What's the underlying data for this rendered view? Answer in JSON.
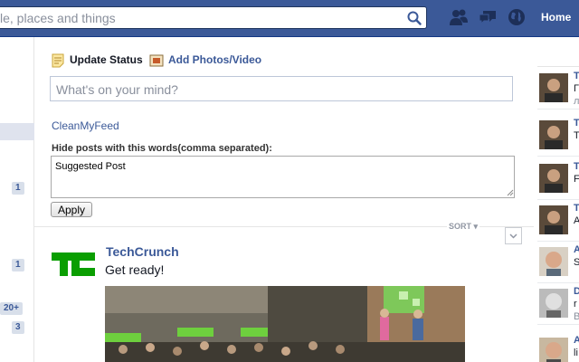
{
  "header": {
    "search_text": "le, places and things",
    "home_label": "Home",
    "icons": [
      "friend-requests-icon",
      "messages-icon",
      "notifications-globe-icon"
    ]
  },
  "left_rail": {
    "badges": [
      "1",
      "1",
      "20+",
      "3"
    ]
  },
  "composer": {
    "tabs": [
      {
        "label": "Update Status",
        "icon": "status-note-icon"
      },
      {
        "label": "Add Photos/Video",
        "icon": "photo-icon"
      }
    ],
    "placeholder": "What's on your mind?"
  },
  "cleanmyfeed": {
    "link": "CleanMyFeed",
    "label": "Hide posts with this words(comma separated):",
    "textarea_value": "Suggested Post",
    "apply_label": "Apply"
  },
  "feed": {
    "sort_label": "SORT",
    "post": {
      "author": "TechCrunch",
      "text": "Get ready!"
    }
  },
  "ticker": {
    "items": [
      {
        "line1": "T",
        "line2": "Γ",
        "line3": "л"
      },
      {
        "line1": "T",
        "line2": "T",
        "line3": ""
      },
      {
        "line1": "T",
        "line2": "F",
        "line3": ""
      },
      {
        "line1": "T",
        "line2": "A",
        "line3": ""
      },
      {
        "line1": "A",
        "line2": "S",
        "line3": ""
      },
      {
        "line1": "D",
        "line2": "r",
        "line3": "B"
      },
      {
        "line1": "A",
        "line2": "li",
        "line3": ""
      }
    ]
  },
  "colors": {
    "brand": "#3b5998",
    "techcrunch_green": "#0a9e01"
  }
}
